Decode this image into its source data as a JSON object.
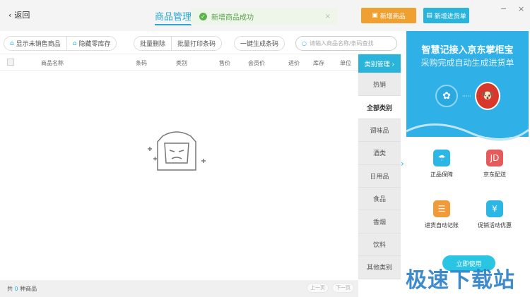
{
  "header": {
    "back_label": "返回",
    "title": "商品管理",
    "toast": "新增商品成功",
    "add_product": "新增商品",
    "add_purchase": "新增进货单",
    "minimize": "−",
    "close": "×"
  },
  "toolbar": {
    "show_unsold": "显示未销售商品",
    "hide_zero_stock": "隐藏零库存",
    "batch_delete": "批量删除",
    "batch_print": "批量打印条码",
    "generate_barcode": "一键生成条码",
    "search_placeholder": "请输入商品名称/条码查找"
  },
  "table": {
    "columns": [
      "商品名称",
      "条码",
      "类别",
      "售价",
      "会员价",
      "进价",
      "库存",
      "单位"
    ]
  },
  "categories": {
    "manage": "类别管理 ›",
    "items": [
      "热销",
      "全部类别",
      "调味品",
      "酒类",
      "日用品",
      "食品",
      "香烟",
      "饮料",
      "其他类别"
    ],
    "active": "全部类别"
  },
  "footer": {
    "prefix": "共",
    "count": "0",
    "suffix": "种商品",
    "prev": "上一页",
    "next": "下一页"
  },
  "promo": {
    "title": "智慧记接入京东掌柜宝",
    "subtitle": "采购完成自动生成进货单",
    "features": [
      "正品保障",
      "京东配送",
      "进货自动记账",
      "促销活动优惠"
    ],
    "cta": "立即使用"
  },
  "watermark": "极速下载站",
  "colors": {
    "accent": "#29a8d6",
    "orange": "#f0a030",
    "cyan": "#2ab4dc",
    "success": "#5cb54a"
  }
}
